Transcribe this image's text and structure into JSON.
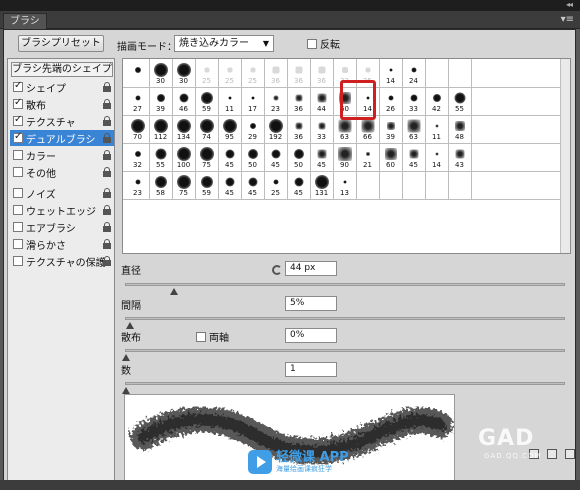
{
  "window": {
    "tab_label": "ブラシ",
    "collapse_glyph": "◂◂",
    "menu_glyph": "▾≡"
  },
  "toolbar": {
    "preset_button": "ブラシプリセット",
    "mode_label": "描画モード：",
    "mode_value": "焼き込みカラー",
    "flip_label": "反転",
    "flip_checked": false
  },
  "options": {
    "header": "ブラシ先端のシェイプ",
    "items": [
      {
        "label": "シェイプ",
        "checked": true,
        "selected": false
      },
      {
        "label": "散布",
        "checked": true,
        "selected": false
      },
      {
        "label": "テクスチャ",
        "checked": true,
        "selected": false
      },
      {
        "label": "デュアルブラシ",
        "checked": true,
        "selected": true
      },
      {
        "label": "カラー",
        "checked": false,
        "selected": false
      },
      {
        "label": "その他",
        "checked": false,
        "selected": false
      },
      {
        "label": "ノイズ",
        "checked": false,
        "selected": false
      },
      {
        "label": "ウェットエッジ",
        "checked": false,
        "selected": false
      },
      {
        "label": "エアブラシ",
        "checked": false,
        "selected": false
      },
      {
        "label": "滑らかさ",
        "checked": false,
        "selected": false
      },
      {
        "label": "テクスチャの保護",
        "checked": false,
        "selected": false
      }
    ]
  },
  "brush_grid": {
    "rows": [
      [
        "",
        "30",
        "30",
        "25",
        "25",
        "25",
        "36",
        "36",
        "36",
        "32",
        "25",
        "14",
        "24"
      ],
      [
        "27",
        "39",
        "46",
        "59",
        "11",
        "17",
        "23",
        "36",
        "44",
        "60",
        "14",
        "26",
        "33",
        "42",
        "55"
      ],
      [
        "70",
        "112",
        "134",
        "74",
        "95",
        "29",
        "192",
        "36",
        "33",
        "63",
        "66",
        "39",
        "63",
        "11",
        "48"
      ],
      [
        "32",
        "55",
        "100",
        "75",
        "45",
        "50",
        "45",
        "50",
        "45",
        "90",
        "21",
        "60",
        "45",
        "14",
        "43"
      ],
      [
        "23",
        "58",
        "75",
        "59",
        "45",
        "45",
        "25",
        "45",
        "131",
        "13"
      ]
    ],
    "selected_size": "44"
  },
  "properties": {
    "diameter_label": "直径",
    "diameter_value": "44 px",
    "diameter_pct": 0.11,
    "spacing_label": "間隔",
    "spacing_value": "5%",
    "spacing_pct": 0.01,
    "scatter_label": "散布",
    "both_axes_label": "両軸",
    "both_axes_checked": false,
    "scatter_value": "0%",
    "scatter_pct": 0.0,
    "count_label": "数",
    "count_value": "1",
    "count_pct": 0.0
  },
  "watermark": {
    "title": "轻微课 APP",
    "subtitle": "海量绘画课疯狂学",
    "corner_logo": "GAD",
    "corner_sub": "GAD.QQ.COM"
  }
}
